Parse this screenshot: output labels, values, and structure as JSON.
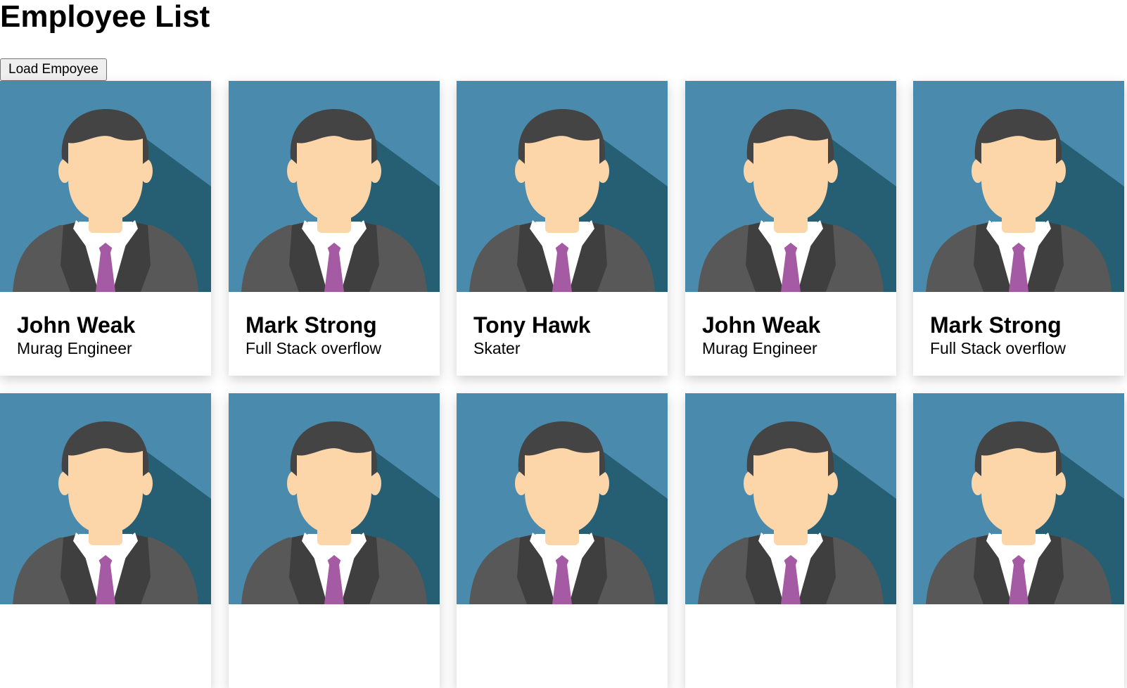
{
  "page": {
    "title": "Employee List",
    "load_button_label": "Load Empoyee"
  },
  "avatar_colors": {
    "background": "#4a8bad",
    "shadow": "#265f73",
    "hair": "#444444",
    "skin": "#fcd5a9",
    "suit": "#585858",
    "lapel": "#3f3f3f",
    "shirt": "#ffffff",
    "tie": "#a55ba3"
  },
  "employees": [
    {
      "name": "John Weak",
      "role": "Murag Engineer"
    },
    {
      "name": "Mark Strong",
      "role": "Full Stack overflow"
    },
    {
      "name": "Tony Hawk",
      "role": "Skater"
    },
    {
      "name": "John Weak",
      "role": "Murag Engineer"
    },
    {
      "name": "Mark Strong",
      "role": "Full Stack overflow"
    },
    {
      "name": "",
      "role": ""
    },
    {
      "name": "",
      "role": ""
    },
    {
      "name": "",
      "role": ""
    },
    {
      "name": "",
      "role": ""
    },
    {
      "name": "",
      "role": ""
    }
  ]
}
